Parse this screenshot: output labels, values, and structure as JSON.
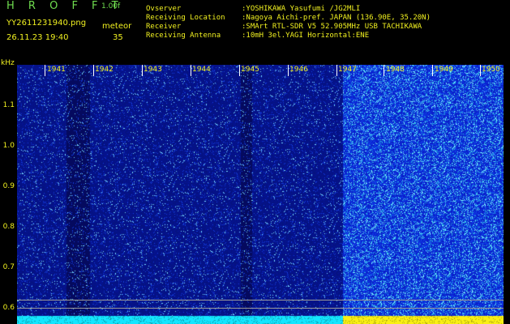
{
  "header": {
    "title": "H R O F F T",
    "version": "1.00f",
    "filename": "YY2611231940.png",
    "datetime": "26.11.23 19:40",
    "mode": "meteor",
    "count": "35"
  },
  "info": [
    {
      "label": "Ovserver",
      "value": ":YOSHIKAWA Yasufumi /JG2MLI"
    },
    {
      "label": "Receiving Location",
      "value": ":Nagoya Aichi-pref. JAPAN (136.90E, 35.20N)"
    },
    {
      "label": "Receiver",
      "value": ":SMArt RTL-SDR V5 52.905MHz USB TACHIKAWA"
    },
    {
      "label": "Receiving Antenna",
      "value": ":10mH 3el.YAGI Horizontal:ENE"
    }
  ],
  "axis": {
    "y_unit": "kHz",
    "y_ticks": [
      "1.1",
      "1.0",
      "0.9",
      "0.8",
      "0.7",
      "0.6"
    ],
    "time_marks": [
      "1941",
      "1942",
      "1943",
      "1944",
      "1945",
      "1946",
      "1947",
      "1948",
      "1949",
      "1950"
    ]
  },
  "colors": {
    "background": "#000000",
    "text_yellow": "#f0f020",
    "text_green": "#6fdc4f",
    "noise_blue": "#0a1a9c",
    "noise_cyan": "#18e8ff"
  }
}
